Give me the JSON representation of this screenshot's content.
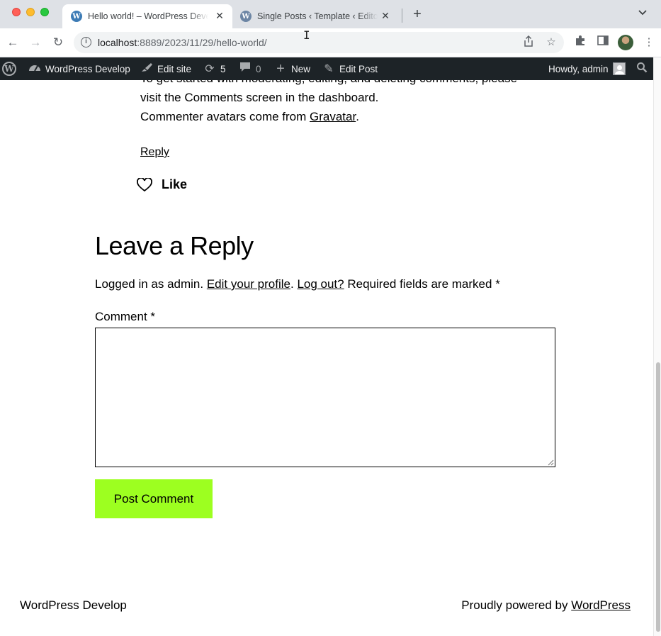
{
  "browser": {
    "tabs": [
      {
        "title": "Hello world! – WordPress Develop",
        "active": true
      },
      {
        "title": "Single Posts ‹ Template ‹ Editor",
        "active": false
      }
    ],
    "url_host": "localhost",
    "url_rest": ":8889/2023/11/29/hello-world/"
  },
  "adminbar": {
    "site_name": "WordPress Develop",
    "edit_site": "Edit site",
    "updates_count": "5",
    "comments_count": "0",
    "new_label": "New",
    "edit_post": "Edit Post",
    "howdy": "Howdy, admin"
  },
  "comment": {
    "line1": "To get started with moderating, editing, and deleting comments, please",
    "line2": "visit the Comments screen in the dashboard.",
    "line3_prefix": "Commenter avatars come from ",
    "gravatar_link": "Gravatar",
    "line3_suffix": ".",
    "reply_link": "Reply",
    "like_label": "Like"
  },
  "reply_form": {
    "title": "Leave a Reply",
    "logged_in_prefix": "Logged in as admin.",
    "edit_profile_link": "Edit your profile",
    "period": ".",
    "logout_link": "Log out?",
    "required_text": "Required fields are marked",
    "required_star": "*",
    "comment_label": "Comment",
    "comment_value": "",
    "submit_label": "Post Comment",
    "accent_color": "#9dff20"
  },
  "footer": {
    "site_title": "WordPress Develop",
    "powered_prefix": "Proudly powered by ",
    "powered_link": "WordPress"
  }
}
